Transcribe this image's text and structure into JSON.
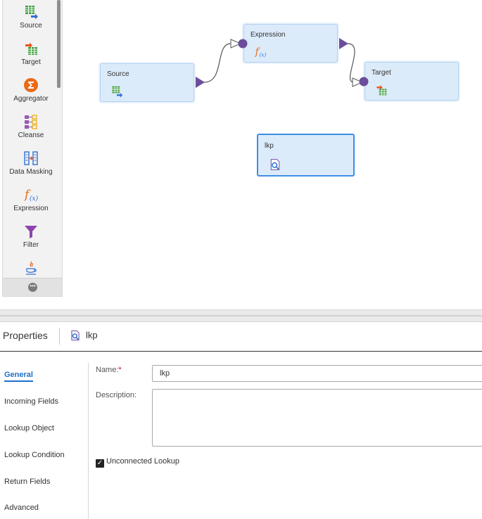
{
  "palette": {
    "items": [
      {
        "label": "Source",
        "icon": "source-icon"
      },
      {
        "label": "Target",
        "icon": "target-icon"
      },
      {
        "label": "Aggregator",
        "icon": "aggregator-icon"
      },
      {
        "label": "Cleanse",
        "icon": "cleanse-icon"
      },
      {
        "label": "Data Masking",
        "icon": "data-masking-icon"
      },
      {
        "label": "Expression",
        "icon": "expression-icon"
      },
      {
        "label": "Filter",
        "icon": "filter-icon"
      }
    ],
    "more_icon": "more-icon"
  },
  "canvas": {
    "nodes": {
      "source": {
        "title": "Source"
      },
      "expression": {
        "title": "Expression"
      },
      "target": {
        "title": "Target"
      },
      "lkp": {
        "title": "lkp"
      }
    }
  },
  "properties": {
    "title": "Properties",
    "object_name": "lkp",
    "nav": [
      "General",
      "Incoming Fields",
      "Lookup Object",
      "Lookup Condition",
      "Return Fields",
      "Advanced"
    ],
    "active_nav": "General",
    "form": {
      "name_label": "Name:",
      "name_required": "*",
      "name_value": "lkp",
      "description_label": "Description:",
      "description_value": "",
      "unconnected_label": "Unconnected Lookup",
      "unconnected_checked": true
    }
  },
  "colors": {
    "node_fill": "#dcebfa",
    "node_border": "#b3d0ee",
    "selected_border": "#3d8ee6",
    "port": "#6b4e9b",
    "accent": "#1f6fc9"
  }
}
